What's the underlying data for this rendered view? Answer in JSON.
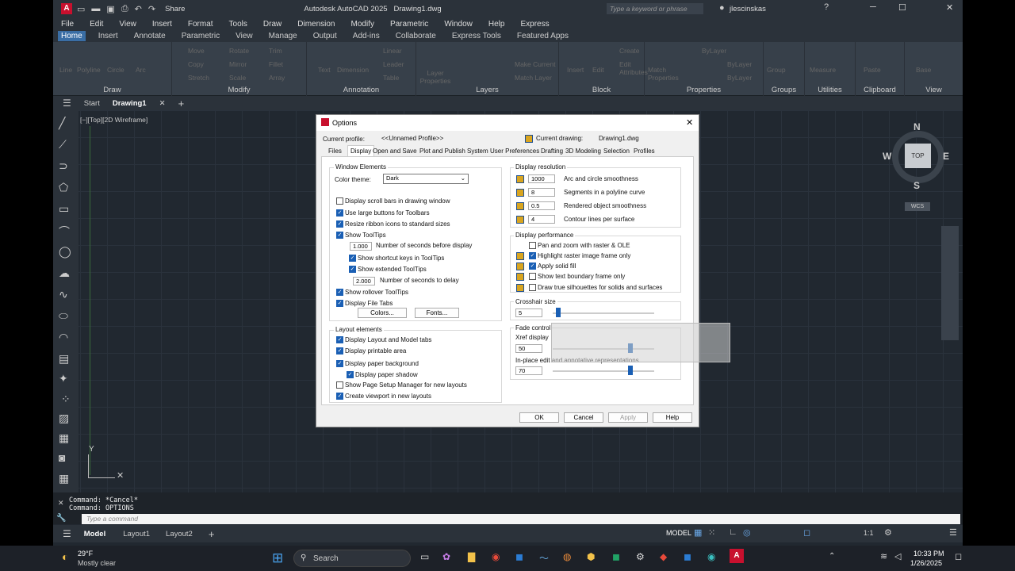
{
  "title": {
    "app": "Autodesk AutoCAD 2025",
    "file": "Drawing1.dwg",
    "share": "Share",
    "search_placeholder": "Type a keyword or phrase",
    "user": "jlescinskas"
  },
  "menu": [
    "File",
    "Edit",
    "View",
    "Insert",
    "Format",
    "Tools",
    "Draw",
    "Dimension",
    "Modify",
    "Parametric",
    "Window",
    "Help",
    "Express"
  ],
  "ribbon_tabs": [
    "Home",
    "Insert",
    "Annotate",
    "Parametric",
    "View",
    "Manage",
    "Output",
    "Add-ins",
    "Collaborate",
    "Express Tools",
    "Featured Apps"
  ],
  "ribbon_panels": [
    "Draw",
    "Modify",
    "Annotation",
    "Layers",
    "Block",
    "Properties",
    "Groups",
    "Utilities",
    "Clipboard",
    "View"
  ],
  "ribbon_tools": {
    "draw": [
      "Line",
      "Polyline",
      "Circle",
      "Arc"
    ],
    "modify": [
      "Move",
      "Rotate",
      "Trim",
      "Copy",
      "Mirror",
      "Fillet",
      "Stretch",
      "Scale",
      "Array"
    ],
    "annotation": [
      "Text",
      "Dimension",
      "Linear",
      "Leader",
      "Table"
    ],
    "layers": [
      "Layer Properties",
      "Make Current",
      "Match Layer"
    ],
    "block": [
      "Insert",
      "Edit",
      "Create",
      "Edit Attributes"
    ],
    "properties": [
      "Match Properties",
      "ByLayer",
      "ByLayer",
      "ByLayer"
    ],
    "groups": "Group",
    "utilities": "Measure",
    "clipboard": "Paste",
    "view": "Base"
  },
  "doc_tabs": {
    "start": "Start",
    "drawing": "Drawing1"
  },
  "viewport_label": "[−][Top][2D Wireframe]",
  "viewcube": {
    "n": "N",
    "s": "S",
    "e": "E",
    "w": "W",
    "top": "TOP",
    "wcs": "WCS"
  },
  "command": {
    "line1": "Command: *Cancel*",
    "line2": "Command: OPTIONS",
    "placeholder": "Type a command"
  },
  "layout_tabs": [
    "Model",
    "Layout1",
    "Layout2"
  ],
  "status": {
    "model": "MODEL",
    "scale": "1:1"
  },
  "taskbar": {
    "temp": "29°F",
    "weather": "Mostly clear",
    "search": "Search",
    "time": "10:33 PM",
    "date": "1/26/2025"
  },
  "dialog": {
    "title": "Options",
    "current_profile_label": "Current profile:",
    "current_profile": "<<Unnamed Profile>>",
    "current_drawing_label": "Current drawing:",
    "current_drawing": "Drawing1.dwg",
    "tabs": [
      "Files",
      "Display",
      "Open and Save",
      "Plot and Publish",
      "System",
      "User Preferences",
      "Drafting",
      "3D Modeling",
      "Selection",
      "Profiles"
    ],
    "window_elements": "Window Elements",
    "color_theme_label": "Color theme:",
    "color_theme": "Dark",
    "we_items": [
      "Display scroll bars in drawing window",
      "Use large buttons for Toolbars",
      "Resize ribbon icons to standard sizes",
      "Show ToolTips",
      "Number of seconds before display",
      "Show shortcut keys in ToolTips",
      "Show extended ToolTips",
      "Number of seconds to delay",
      "Show rollover ToolTips",
      "Display File Tabs"
    ],
    "seconds_before": "1.000",
    "seconds_delay": "2.000",
    "colors_btn": "Colors...",
    "fonts_btn": "Fonts...",
    "layout_elements": "Layout elements",
    "le_items": [
      "Display Layout and Model tabs",
      "Display printable area",
      "Display paper background",
      "Display paper shadow",
      "Show Page Setup Manager for new layouts",
      "Create viewport in new layouts"
    ],
    "display_resolution": "Display resolution",
    "dr_items": [
      {
        "v": "1000",
        "l": "Arc and circle smoothness"
      },
      {
        "v": "8",
        "l": "Segments in a polyline curve"
      },
      {
        "v": "0.5",
        "l": "Rendered object smoothness"
      },
      {
        "v": "4",
        "l": "Contour lines per surface"
      }
    ],
    "display_performance": "Display performance",
    "dp_items": [
      "Pan and zoom with raster & OLE",
      "Highlight raster image frame only",
      "Apply solid fill",
      "Show text boundary frame only",
      "Draw true silhouettes for solids and surfaces"
    ],
    "crosshair": "Crosshair size",
    "crosshair_val": "5",
    "fade": "Fade control",
    "xref": "Xref display",
    "xref_val": "50",
    "inplace": "In-place edit and annotative representations",
    "inplace_val": "70",
    "ok": "OK",
    "cancel": "Cancel",
    "apply": "Apply",
    "help": "Help"
  }
}
